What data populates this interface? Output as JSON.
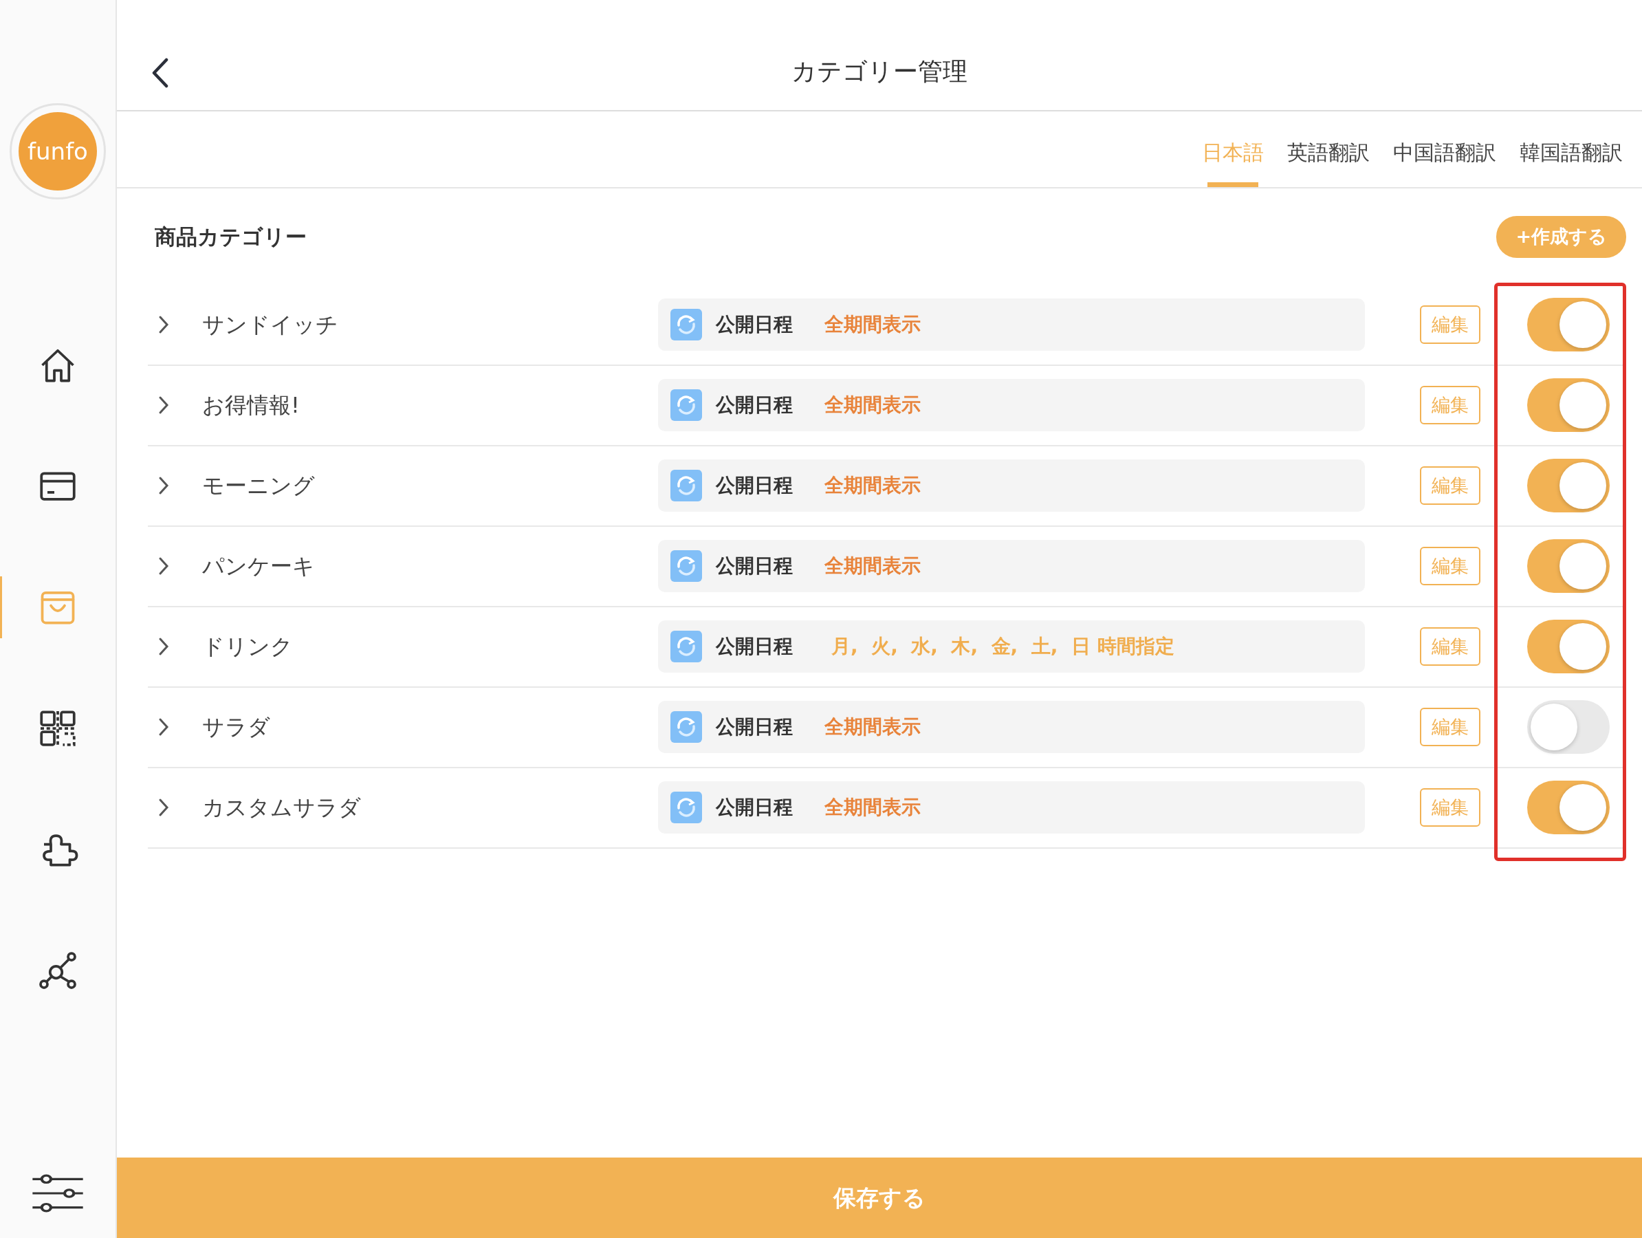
{
  "sidebar": {
    "logo": "funfo",
    "items": [
      {
        "kind": "home",
        "selected": false
      },
      {
        "kind": "card",
        "selected": false
      },
      {
        "kind": "bag",
        "selected": true
      },
      {
        "kind": "qr",
        "selected": false
      },
      {
        "kind": "puzzle",
        "selected": false
      },
      {
        "kind": "network",
        "selected": false
      },
      {
        "kind": "sliders",
        "selected": false
      }
    ]
  },
  "header": {
    "title": "カテゴリー管理"
  },
  "tabs": [
    {
      "label": "日本語",
      "selected": true
    },
    {
      "label": "英語翻訳",
      "selected": false
    },
    {
      "label": "中国語翻訳",
      "selected": false
    },
    {
      "label": "韓国語翻訳",
      "selected": false
    }
  ],
  "section": {
    "title": "商品カテゴリー",
    "create_button": "+作成する"
  },
  "categories": [
    {
      "name": "サンドイッチ",
      "schedule_label": "公開日程",
      "schedule": "全期間表示",
      "kind": "all",
      "edit": "編集",
      "on": true
    },
    {
      "name": "お得情報!",
      "schedule_label": "公開日程",
      "schedule": "全期間表示",
      "kind": "all",
      "edit": "編集",
      "on": true
    },
    {
      "name": "モーニング",
      "schedule_label": "公開日程",
      "schedule": "全期間表示",
      "kind": "all",
      "edit": "編集",
      "on": true
    },
    {
      "name": "パンケーキ",
      "schedule_label": "公開日程",
      "schedule": "全期間表示",
      "kind": "all",
      "edit": "編集",
      "on": true
    },
    {
      "name": "ドリンク",
      "schedule_label": "公開日程",
      "schedule": "月,  火,  水,  木,  金,  土,  日 時間指定",
      "kind": "timed",
      "edit": "編集",
      "on": true
    },
    {
      "name": "サラダ",
      "schedule_label": "公開日程",
      "schedule": "全期間表示",
      "kind": "all",
      "edit": "編集",
      "on": false
    },
    {
      "name": "カスタムサラダ",
      "schedule_label": "公開日程",
      "schedule": "全期間表示",
      "kind": "all",
      "edit": "編集",
      "on": true
    }
  ],
  "save_button": "保存する"
}
